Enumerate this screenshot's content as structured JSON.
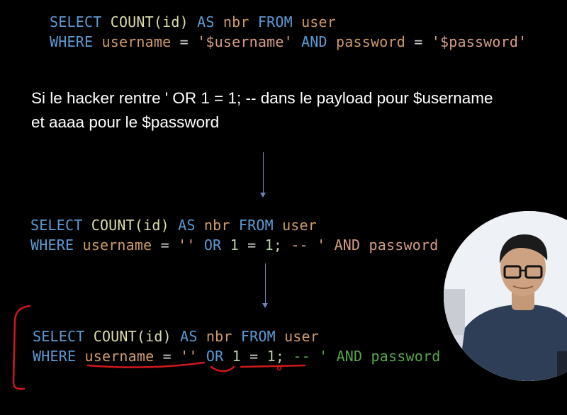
{
  "slide": {
    "code_block_1": {
      "line1": {
        "t1": "SELECT",
        "t2": "COUNT(id)",
        "t3": "AS",
        "t4": "nbr",
        "t5": "FROM",
        "t6": "user"
      },
      "line2": {
        "t1": "WHERE",
        "t2": "username",
        "t3": "=",
        "t4": "'$username'",
        "t5": "AND",
        "t6": "password",
        "t7": "=",
        "t8": "'$password'"
      }
    },
    "explanation": {
      "line1": "Si le hacker rentre ' OR 1 = 1; --  dans le payload pour $username",
      "line2": "et aaaa pour le $password"
    },
    "code_block_2": {
      "line1": {
        "t1": "SELECT",
        "t2": "COUNT(id)",
        "t3": "AS",
        "t4": "nbr",
        "t5": "FROM",
        "t6": "user"
      },
      "line2": {
        "t1": "WHERE",
        "t2": "username",
        "t3": "=",
        "t4": "''",
        "t5": "OR",
        "t6": "1",
        "t7": "=",
        "t8": "1;",
        "t9": "-- ' AND password"
      }
    },
    "code_block_3": {
      "line1": {
        "t1": "SELECT",
        "t2": "COUNT(id)",
        "t3": "AS",
        "t4": "nbr",
        "t5": "FROM",
        "t6": "user"
      },
      "line2": {
        "t1": "WHERE",
        "t2": "username",
        "t3": "=",
        "t4": "''",
        "t5": "OR",
        "t6": "1",
        "t7": "=",
        "t8": "1;",
        "t9": "-- ' AND password"
      }
    }
  },
  "colors": {
    "background": "#000000",
    "keyword": "#5b9bd5",
    "identifier": "#cf9b6a",
    "function": "#dcdcaa",
    "comment": "#57a64a",
    "annotation_ink": "#d0181c",
    "arrow": "#6f83b8"
  }
}
